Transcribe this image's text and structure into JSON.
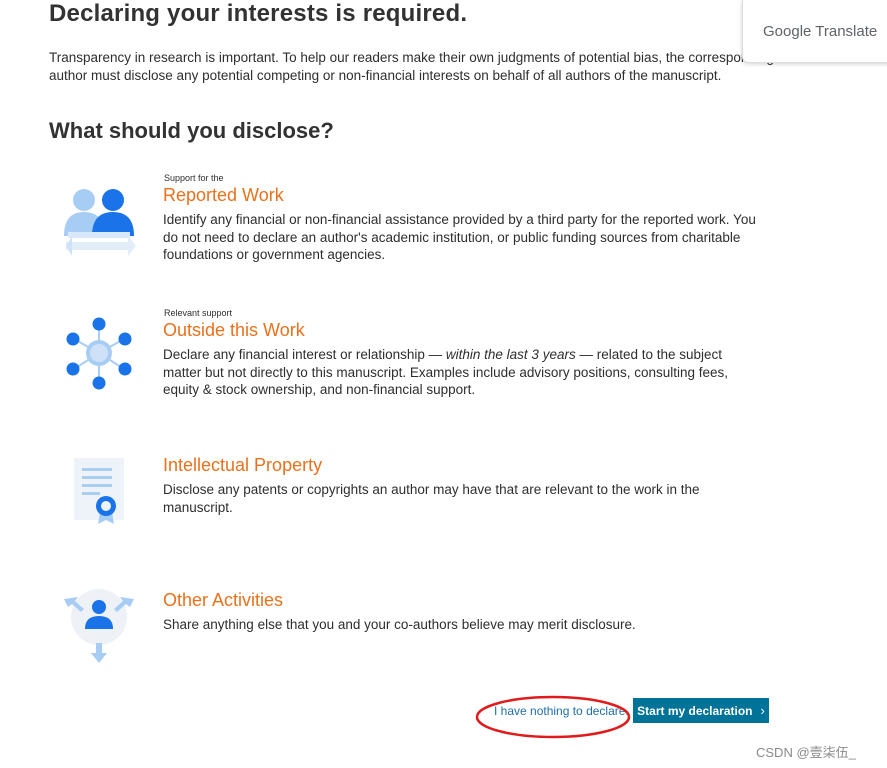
{
  "page": {
    "title": "Declaring your interests is required.",
    "intro": "Transparency in research is important. To help our readers make their own judgments of potential bias, the corresponding author must disclose any potential competing or non-financial interests on behalf of all authors of the manuscript.",
    "subtitle": "What should you disclose?"
  },
  "sections": [
    {
      "kicker": "Support for the",
      "heading": "Reported Work",
      "icon": "people-support-icon",
      "description": "Identify any financial or non-financial assistance provided by a third party for the reported work. You do not need to declare an author's academic institution, or public funding sources from charitable foundations or government agencies."
    },
    {
      "kicker": "Relevant support",
      "heading": "Outside this Work",
      "icon": "network-hub-icon",
      "description_before": "Declare any financial interest or relationship — ",
      "description_emphasis": "within the last 3 years",
      "description_after": " — related to the subject matter but not directly to this manuscript. Examples include advisory positions, consulting fees, equity & stock ownership, and non-financial support."
    },
    {
      "heading": "Intellectual Property",
      "icon": "certificate-icon",
      "description": "Disclose any patents or copyrights an author may have that are relevant to the work in the manuscript."
    },
    {
      "heading": "Other Activities",
      "icon": "person-arrows-icon",
      "description": "Share anything else that you and your co-authors believe may merit disclosure."
    }
  ],
  "actions": {
    "nothing_label": "I have nothing to declare.",
    "start_label": "Start my declaration",
    "start_icon": "chevron-right-icon"
  },
  "google_translate": {
    "label": "Google Translate"
  },
  "watermark": "CSDN @壹柒伍_",
  "colors": {
    "heading_orange": "#e9711c",
    "button_teal": "#007398",
    "link_blue": "#1f6fa8",
    "icon_blue": "#1a73e8",
    "icon_light_blue": "#a8cdf5",
    "annotation_red": "#e01b1b"
  }
}
